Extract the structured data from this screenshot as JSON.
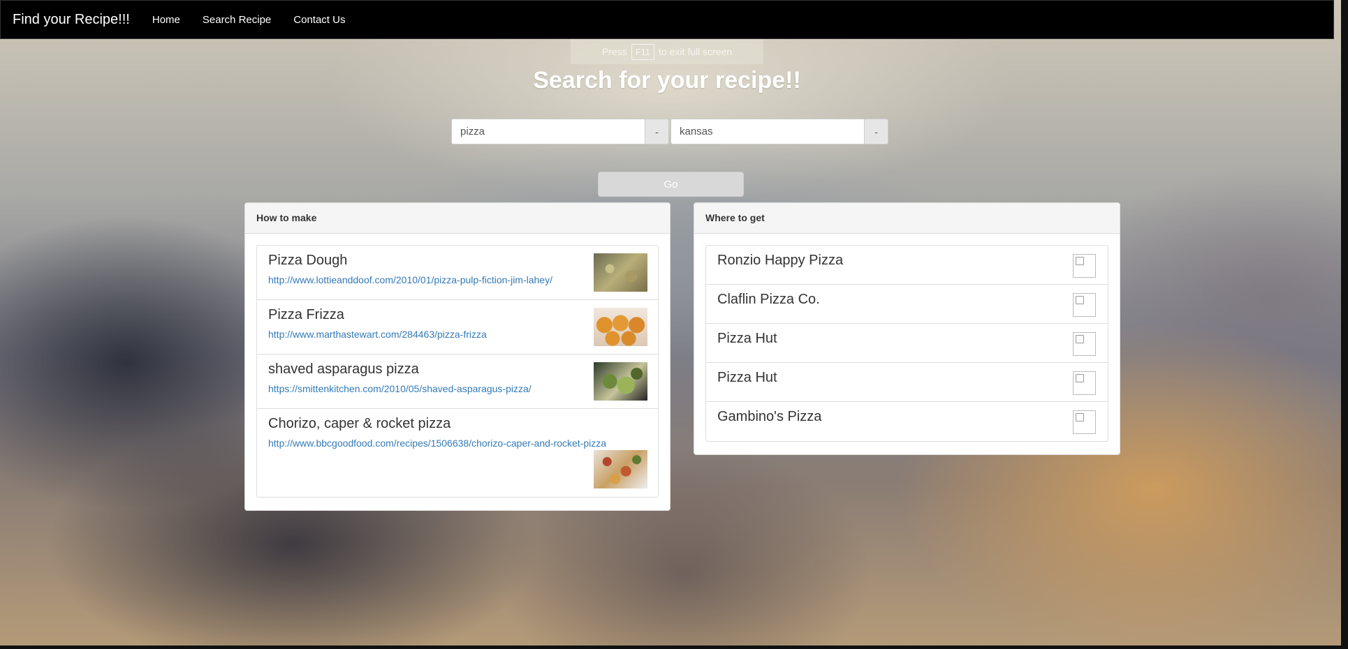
{
  "navbar": {
    "brand": "Find your Recipe!!!",
    "links": [
      "Home",
      "Search Recipe",
      "Contact Us"
    ]
  },
  "fullscreen_hint": {
    "prefix": "Press",
    "key": "F11",
    "suffix": "to exit full screen"
  },
  "heading": "Search for your recipe!!",
  "search": {
    "dish_value": "pizza",
    "location_value": "kansas",
    "addon_label": "-",
    "go_label": "Go"
  },
  "how_to_make": {
    "title": "How to make",
    "items": [
      {
        "title": "Pizza Dough",
        "link": "http://www.lottieanddoof.com/2010/01/pizza-pulp-fiction-jim-lahey/",
        "image": "pizza-dough-photo"
      },
      {
        "title": "Pizza Frizza",
        "link": "http://www.marthastewart.com/284463/pizza-frizza",
        "image": "pizza-frizza-photo"
      },
      {
        "title": "shaved asparagus pizza",
        "link": "https://smittenkitchen.com/2010/05/shaved-asparagus-pizza/",
        "image": "asparagus-pizza-photo"
      },
      {
        "title": "Chorizo, caper & rocket pizza",
        "link": "http://www.bbcgoodfood.com/recipes/1506638/chorizo-caper-and-rocket-pizza",
        "image": "chorizo-pizza-photo"
      }
    ]
  },
  "where_to_get": {
    "title": "Where to get",
    "items": [
      {
        "name": "Ronzio Happy Pizza"
      },
      {
        "name": "Claflin Pizza Co."
      },
      {
        "name": "Pizza Hut"
      },
      {
        "name": "Pizza Hut"
      },
      {
        "name": "Gambino's Pizza"
      }
    ]
  }
}
